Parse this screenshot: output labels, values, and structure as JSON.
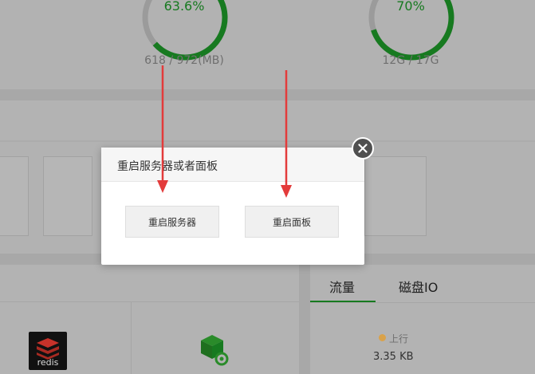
{
  "stats": {
    "memory": {
      "percent": "63.6%",
      "usage": "618 / 972(MB)",
      "fraction": 0.636
    },
    "disk": {
      "percent": "70%",
      "usage": "12G / 17G",
      "fraction": 0.7
    }
  },
  "tabs": {
    "traffic": "流量",
    "disk_io": "磁盘IO"
  },
  "traffic": {
    "upload_label": "上行",
    "upload_value": "3.35 KB"
  },
  "apps": {
    "redis_label": "redis"
  },
  "dialog": {
    "title": "重启服务器或者面板",
    "restart_server": "重启服务器",
    "restart_panel": "重启面板"
  },
  "colors": {
    "accent": "#177a20",
    "arrow": "#e33b3b",
    "upload_dot": "#d9a24a"
  }
}
